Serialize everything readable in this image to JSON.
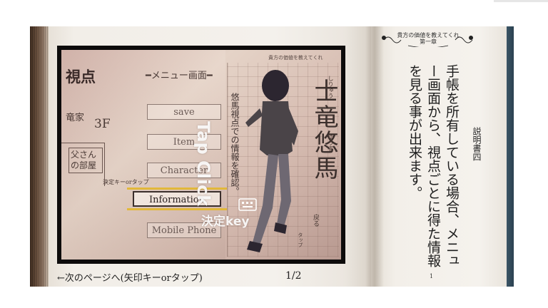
{
  "illustration": {
    "viewpoint_label": "視点",
    "menu_screen_label": "メニュー画面",
    "floor_label": "竜家",
    "floor_value": "3F",
    "room_label": "父さんの部屋",
    "decide_note": "決定キーorタップ",
    "menu_buttons": [
      "save",
      "Item",
      "Character",
      "Information",
      "Mobile Phone"
    ],
    "selected_button": "Information",
    "hero_name": "士竜悠馬",
    "hero_ruby_surname": "しりゅう",
    "hero_ruby_given": "ゆうま",
    "hero_caption": "悠馬視点での情報を確認。",
    "note_top": "貴方の価値を教えてくれ",
    "note_back": "戻る",
    "note_tap": "タップ",
    "tap_hint": "Tap Click",
    "key_hint": "決定key"
  },
  "right_page": {
    "chapter_title": "貴方の価値を教えてくれ",
    "chapter_subtitle": "第一章",
    "manual_label": "説明書四",
    "description": "手帳を所有している場合、メニュー画面から、視点ごとに得た情報を見る事が出来ます。",
    "page_number": "1"
  },
  "footer": {
    "next_page_hint": "←次のページへ(矢印キーorタップ)",
    "page_counter": "1/2"
  },
  "colors": {
    "selection_bar": "#e2b83a",
    "frame": "#0d0b0b",
    "book_edge": "#2b4150"
  }
}
